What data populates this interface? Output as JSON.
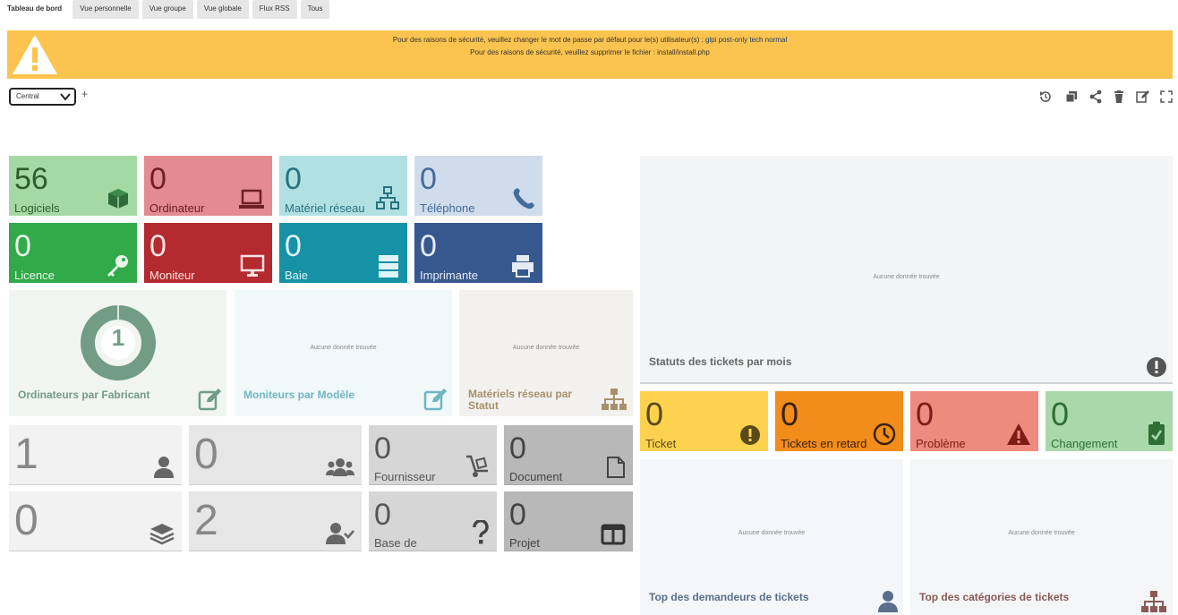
{
  "tabs": [
    "Tableau de bord",
    "Vue personnelle",
    "Vue groupe",
    "Vue globale",
    "Flux RSS",
    "Tous"
  ],
  "warning": {
    "line1_prefix": "Pour des raisons de sécurité, veuillez changer le mot de passe par défaut pour le(s) utilisateur(s) : ",
    "line1_users": "glpi post-only tech normal",
    "line2": "Pour des raisons de sécurité, veuillez supprimer le fichier : install/install.php"
  },
  "dashboard_select": "Central",
  "plus": "+",
  "asset_cards": [
    {
      "value": "56",
      "label": "Logiciels"
    },
    {
      "value": "0",
      "label": "Ordinateur"
    },
    {
      "value": "0",
      "label": "Matériel réseau"
    },
    {
      "value": "0",
      "label": "Téléphone"
    },
    {
      "value": "0",
      "label": "Licence"
    },
    {
      "value": "0",
      "label": "Moniteur"
    },
    {
      "value": "0",
      "label": "Baie"
    },
    {
      "value": "0",
      "label": "Imprimante"
    }
  ],
  "widgets": {
    "pc_by_maker": {
      "title": "Ordinateurs par Fabricant",
      "donut_value": "1"
    },
    "monitors_by_model": {
      "title": "Moniteurs par Modèle",
      "nodata": "Aucune donnée trouvée"
    },
    "network_by_status": {
      "title": "Matériels réseau par Statut",
      "nodata": "Aucune donnée trouvée"
    },
    "tickets_by_month": {
      "title": "Statuts des tickets par mois",
      "nodata": "Aucune donnée trouvée"
    },
    "top_requesters": {
      "title": "Top des demandeurs de tickets",
      "nodata": "Aucune donnée trouvée"
    },
    "top_categories": {
      "title": "Top des catégories de tickets",
      "nodata": "Aucune donnée trouvée"
    }
  },
  "admin_cards": [
    {
      "value": "1",
      "label": ""
    },
    {
      "value": "0",
      "label": ""
    },
    {
      "value": "0",
      "label": "Fournisseur"
    },
    {
      "value": "0",
      "label": "Document"
    },
    {
      "value": "0",
      "label": ""
    },
    {
      "value": "2",
      "label": ""
    },
    {
      "value": "0",
      "label": "Base de"
    },
    {
      "value": "0",
      "label": "Projet"
    }
  ],
  "ticket_cards": [
    {
      "value": "0",
      "label": "Ticket"
    },
    {
      "value": "0",
      "label": "Tickets en retard"
    },
    {
      "value": "0",
      "label": "Problème"
    },
    {
      "value": "0",
      "label": "Changement"
    }
  ],
  "colors": {
    "warning": "#fcc44e",
    "software": "#a5d9a4",
    "computer": "#e48b8f",
    "network": "#b1e0e3",
    "phone": "#cfdcec",
    "license": "#31aa49",
    "monitor": "#b42a2e",
    "rack": "#1592a6",
    "printer": "#36588f"
  }
}
